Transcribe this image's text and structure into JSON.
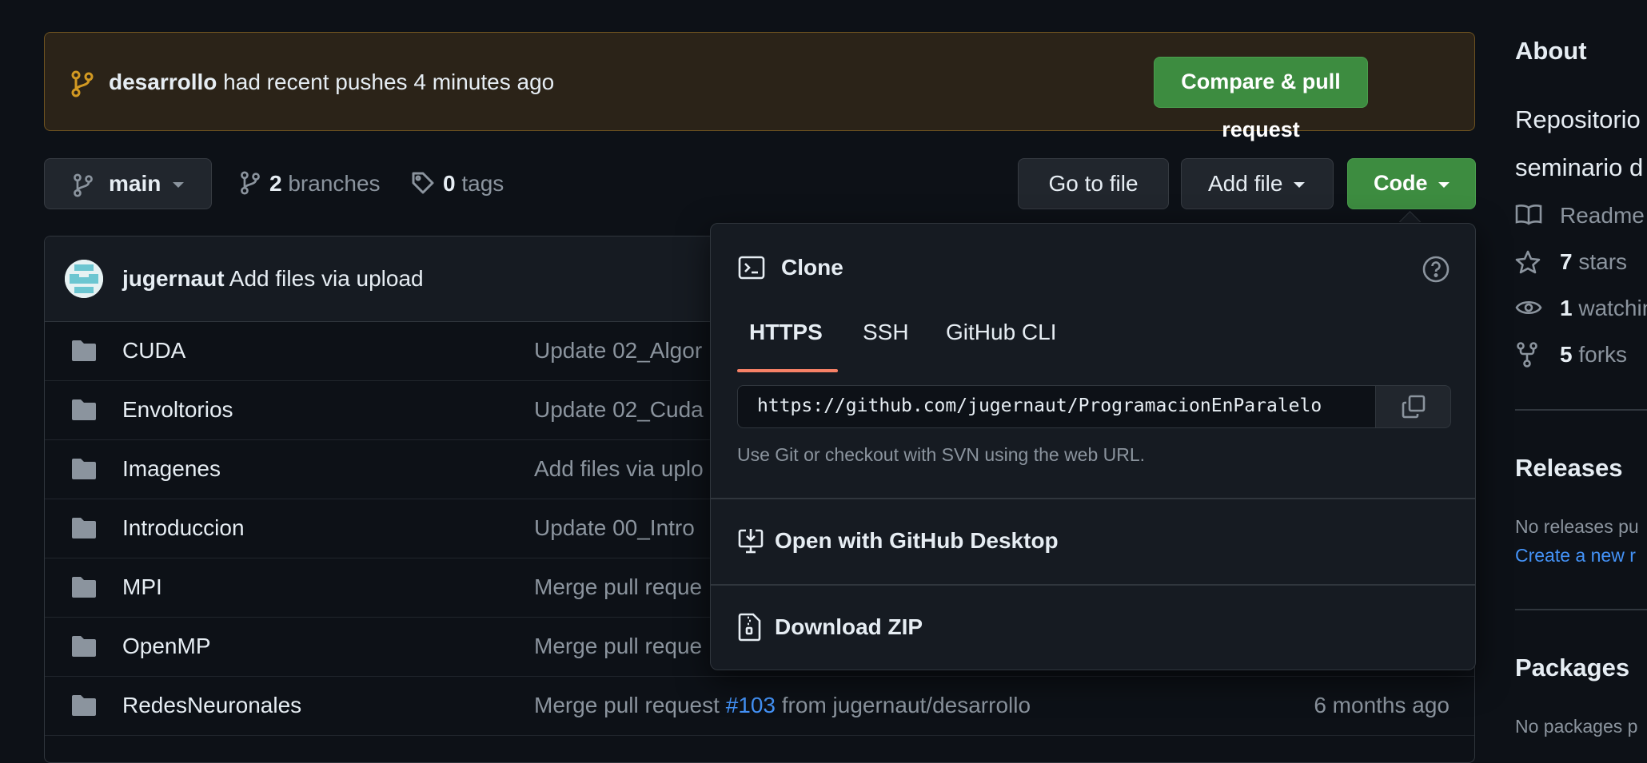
{
  "banner": {
    "branch": "desarrollo",
    "message": "had recent pushes 4 minutes ago",
    "compare_button": "Compare & pull request"
  },
  "branch_bar": {
    "current_branch": "main",
    "branches_count": "2",
    "branches_label": "branches",
    "tags_count": "0",
    "tags_label": "tags",
    "go_to_file": "Go to file",
    "add_file": "Add file",
    "code": "Code"
  },
  "latest_commit": {
    "author": "jugernaut",
    "message": "Add files via upload"
  },
  "files": [
    {
      "name": "CUDA",
      "message": "Update 02_Algor",
      "date": ""
    },
    {
      "name": "Envoltorios",
      "message": "Update 02_Cuda",
      "date": ""
    },
    {
      "name": "Imagenes",
      "message": "Add files via uplo",
      "date": ""
    },
    {
      "name": "Introduccion",
      "message": "Update 00_Intro",
      "date": ""
    },
    {
      "name": "MPI",
      "message": "Merge pull reque",
      "date": ""
    },
    {
      "name": "OpenMP",
      "message": "Merge pull reque",
      "date": ""
    },
    {
      "name": "RedesNeuronales",
      "message_prefix": "Merge pull request ",
      "pr_link": "#103",
      "message_suffix": " from jugernaut/desarrollo",
      "date": "6 months ago"
    }
  ],
  "clone": {
    "title": "Clone",
    "tabs": [
      "HTTPS",
      "SSH",
      "GitHub CLI"
    ],
    "active_tab": "HTTPS",
    "url": "https://github.com/jugernaut/ProgramacionEnParalelo",
    "help_text": "Use Git or checkout with SVN using the web URL.",
    "open_desktop": "Open with GitHub Desktop",
    "download_zip": "Download ZIP"
  },
  "sidebar": {
    "about_title": "About",
    "description_line1": "Repositorio",
    "description_line2": "seminario d",
    "readme": "Readme",
    "stars_count": "7",
    "stars_label": "stars",
    "watching_count": "1",
    "watching_label": "watchin",
    "forks_count": "5",
    "forks_label": "forks",
    "releases_title": "Releases",
    "no_releases": "No releases pu",
    "create_release": "Create a new r",
    "packages_title": "Packages",
    "no_packages": "No packages p"
  },
  "colors": {
    "background": "#0d1117",
    "banner_bg": "#2b2318",
    "banner_border": "#6e5320",
    "primary_green": "#3d8c40",
    "link_blue": "#4493f8",
    "tab_underline": "#f78166",
    "muted_text": "#8b949e"
  },
  "icons": [
    "git-branch-icon",
    "tag-icon",
    "file-directory-icon",
    "terminal-icon",
    "question-icon",
    "copy-icon",
    "desktop-download-icon",
    "file-zip-icon",
    "book-icon",
    "star-icon",
    "eye-icon",
    "repo-forked-icon"
  ]
}
